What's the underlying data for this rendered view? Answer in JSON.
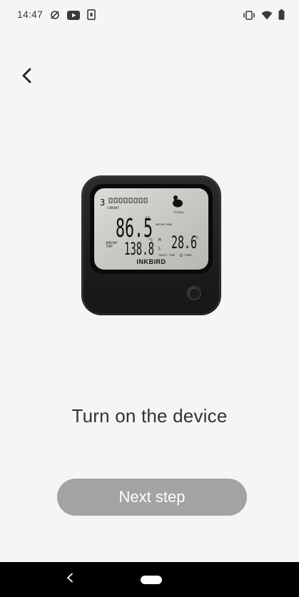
{
  "status_bar": {
    "time": "14:47",
    "left_icons": [
      "sync-off-icon",
      "youtube-icon",
      "device-info-icon"
    ],
    "right_icons": [
      "vibrate-icon",
      "wifi-icon",
      "battery-icon"
    ]
  },
  "header": {
    "back_icon": "chevron-left-icon"
  },
  "device": {
    "brand": "INKBIRD",
    "probe_number": "3",
    "current_temp": "86.5",
    "current_label": "CURRENT",
    "ambient_label_1": "AMBIENT",
    "ambient_label_2": "TEMP",
    "ambient_temp": "138.8",
    "target_temp": "28.6",
    "high_label": "H",
    "low_label": "L",
    "medium_rare_label": "MEDIUM RARE",
    "target_temp_label": "TARGET TEMP",
    "timer_label": "TIMER",
    "food_label": "Turkey",
    "unit": "°C"
  },
  "main": {
    "instruction": "Turn on the device",
    "next_button_label": "Next step"
  },
  "nav_bar": {
    "back_icon": "nav-back-icon",
    "home_icon": "nav-home-pill"
  },
  "colors": {
    "background": "#f5f5f5",
    "button_bg": "#a3a3a5",
    "button_text": "#ffffff",
    "nav_bar": "#000000"
  }
}
